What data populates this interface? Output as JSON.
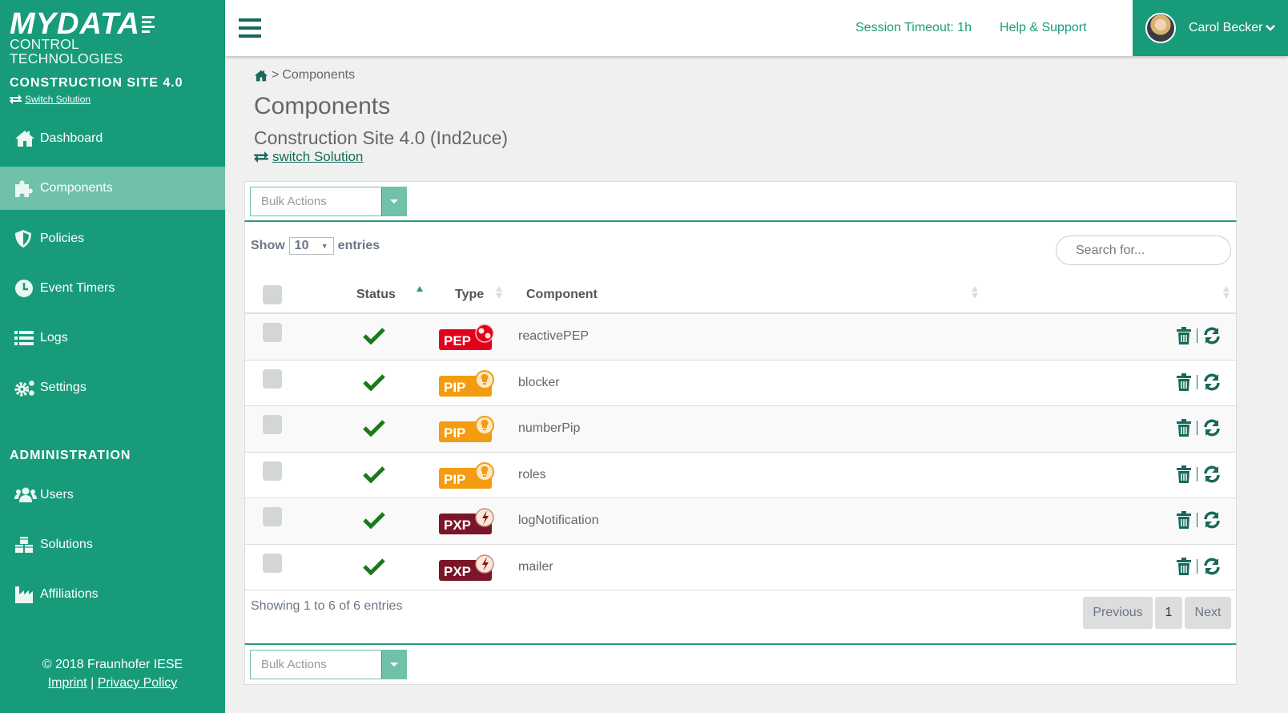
{
  "brand": {
    "logo_main": "MYDATA",
    "logo_sub": "CONTROL TECHNOLOGIES",
    "accent_color": "#189b7b",
    "active_color": "#6fc1a9",
    "dark_accent": "#17695a"
  },
  "sidebar": {
    "solution_name": "CONSTRUCTION SITE 4.0",
    "switch_solution_label": "Switch Solution",
    "items": [
      {
        "label": "Dashboard",
        "icon": "home-icon"
      },
      {
        "label": "Components",
        "icon": "puzzle-icon",
        "active": true
      },
      {
        "label": "Policies",
        "icon": "shield-icon"
      },
      {
        "label": "Event Timers",
        "icon": "clock-icon"
      },
      {
        "label": "Logs",
        "icon": "list-icon"
      },
      {
        "label": "Settings",
        "icon": "gears-icon"
      }
    ],
    "admin_heading": "ADMINISTRATION",
    "admin_items": [
      {
        "label": "Users",
        "icon": "users-icon"
      },
      {
        "label": "Solutions",
        "icon": "cubes-icon"
      },
      {
        "label": "Affiliations",
        "icon": "industry-icon"
      }
    ],
    "footer": {
      "copyright": "© 2018 Fraunhofer IESE",
      "imprint": "Imprint",
      "separator": "|",
      "privacy": "Privacy Policy"
    }
  },
  "header": {
    "session_timeout": "Session Timeout: 1h",
    "help": "Help & Support",
    "user_name": "Carol Becker"
  },
  "main": {
    "breadcrumb": {
      "separator": ">",
      "current": "Components"
    },
    "title": "Components",
    "subtitle": "Construction Site 4.0 (Ind2uce)",
    "switch_solution": "switch Solution",
    "bulk_actions": "Bulk Actions",
    "show_label": "Show",
    "entries_label": "entries",
    "page_size": "10",
    "search_placeholder": "Search for...",
    "columns": {
      "status": "Status",
      "type": "Type",
      "component": "Component"
    },
    "sort": {
      "column": "Status",
      "direction": "ascending"
    },
    "rows": [
      {
        "status": "active",
        "type": "PEP",
        "name": "reactivePEP"
      },
      {
        "status": "active",
        "type": "PIP",
        "name": "blocker"
      },
      {
        "status": "active",
        "type": "PIP",
        "name": "numberPip"
      },
      {
        "status": "active",
        "type": "PIP",
        "name": "roles"
      },
      {
        "status": "active",
        "type": "PXP",
        "name": "logNotification"
      },
      {
        "status": "active",
        "type": "PXP",
        "name": "mailer"
      }
    ],
    "type_colors": {
      "PEP": "#e2001a",
      "PIP": "#f39c12",
      "PXP": "#7b1528"
    },
    "showing": "Showing 1 to 6 of 6 entries",
    "pagination": {
      "previous": "Previous",
      "current_page": "1",
      "next": "Next"
    }
  }
}
